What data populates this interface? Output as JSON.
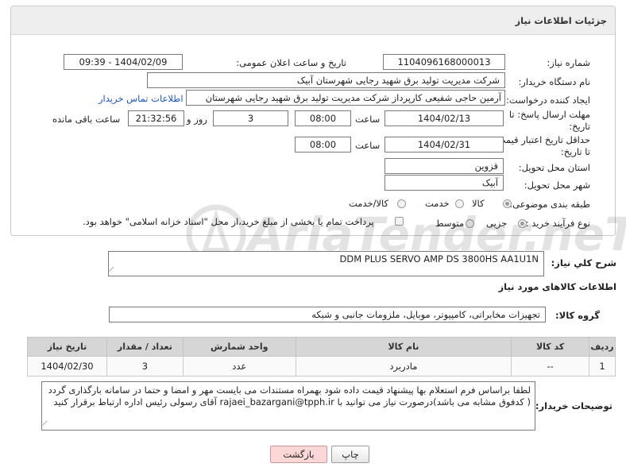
{
  "header": {
    "title": "جزئیات اطلاعات نیاز"
  },
  "fields": {
    "need_number": {
      "label": "شماره نیاز:",
      "value": "1104096168000013"
    },
    "announce_datetime": {
      "label": "تاریخ و ساعت اعلان عمومی:",
      "value": "1404/02/09 - 09:39"
    },
    "buyer_org": {
      "label": "نام دستگاه خریدار:",
      "value": "شرکت مدیریت تولید برق شهید رجایی شهرستان آبیک"
    },
    "requester": {
      "label": "ایجاد کننده درخواست:",
      "value": "آرمین حاجی شفیعی کارپرداز شرکت مدیریت تولید برق شهید رجایی شهرستان",
      "contact_link": "اطلاعات تماس خریدار"
    },
    "reply_deadline": {
      "label_line1": "مهلت ارسال پاسخ: تا",
      "label_line2": "تاریخ:",
      "date": "1404/02/13",
      "time_label": "ساعت",
      "time": "08:00",
      "days": "3",
      "days_label": "روز و",
      "remaining": "21:32:56",
      "remaining_label": "ساعت باقی مانده"
    },
    "price_validity": {
      "label_line1": "حداقل تاریخ اعتبار قیمت:",
      "label_line2": "تا تاریخ:",
      "date": "1404/02/31",
      "time_label": "ساعت",
      "time": "08:00"
    },
    "province": {
      "label": "استان محل تحویل:",
      "value": "قزوین"
    },
    "city": {
      "label": "شهر محل تحویل:",
      "value": "آبیک"
    },
    "category": {
      "label": "طبقه بندی موضوعی:",
      "options": [
        "کالا",
        "خدمت",
        "کالا/خدمت"
      ],
      "selected": "کالا"
    },
    "process_type": {
      "label": "نوع فرآیند خرید :",
      "options": [
        "جزیی",
        "متوسط"
      ],
      "selected": "جزیی",
      "payment_note": "پرداخت تمام یا بخشی از مبلغ خرید،از محل \"اسناد خزانه اسلامی\" خواهد بود."
    }
  },
  "general_description": {
    "label": "شرح کلي نياز:",
    "value": "DDM PLUS SERVO AMP DS 3800HS AA1U1N"
  },
  "goods_section": {
    "title": "اطلاعات کالاهای مورد نیاز",
    "group_label": "گروه کالا:",
    "group_value": "تجهیزات مخابراتی، کامپیوتر، موبایل، ملزومات جانبی و شبکه",
    "columns": [
      "ردیف",
      "کد کالا",
      "نام کالا",
      "واحد شمارش",
      "تعداد / مقدار",
      "تاریخ نیاز"
    ],
    "rows": [
      {
        "row": "1",
        "code": "--",
        "name": "مادربرد",
        "unit": "عدد",
        "qty": "3",
        "date": "1404/02/30"
      }
    ]
  },
  "buyer_notes": {
    "label": "توضیحات خریدار:",
    "text": "لطفا براساس فرم استعلام بها پیشنهاد قیمت داده شود بهمراه مستندات می بایست مهر و امضا و حتما در سامانه بارگذاری گردد ( کدفوق مشابه می باشد)درصورت نیاز می توانید با rajaei_bazargani@tpph.ir آقای رسولی رئیس  اداره ارتباط برقرار کنید"
  },
  "buttons": {
    "print": "چاپ",
    "back": "بازگشت"
  },
  "watermark": {
    "text": "AriaTender.neT"
  },
  "colors": {
    "link": "#1a56c8",
    "back_button": "#fdd7d7",
    "table_header": "#d6d6d6"
  }
}
